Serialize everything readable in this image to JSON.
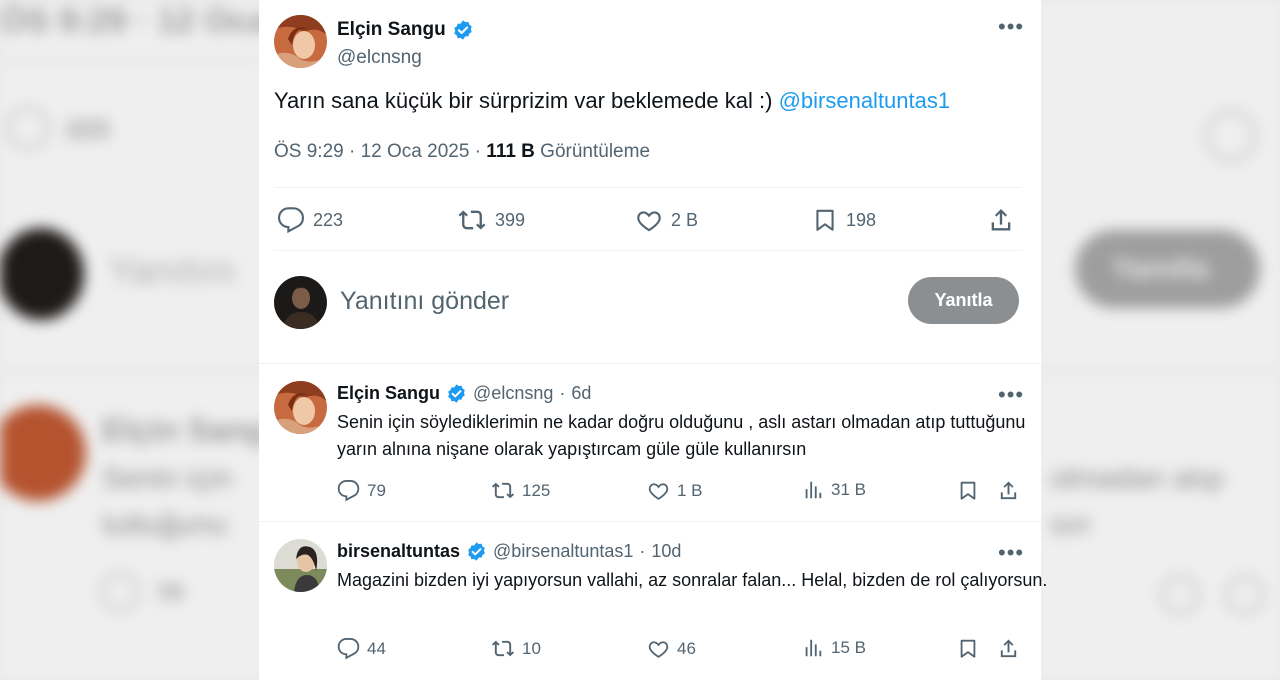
{
  "main_tweet": {
    "author_name": "Elçin Sangu",
    "author_handle": "@elcnsng",
    "text_before": "Yarın sana küçük bir sürprizim var beklemede kal :) ",
    "mention": "@birsenaltuntas1",
    "time": "ÖS 9:29 · 12 Oca 2025 · ",
    "views_count": "111 B",
    "views_label": " Görüntüleme",
    "replies": "223",
    "retweets": "399",
    "likes": "2 B",
    "bookmarks": "198"
  },
  "composer": {
    "placeholder": "Yanıtını gönder",
    "button_label": "Yanıtla"
  },
  "replies": [
    {
      "author_name": "Elçin Sangu",
      "author_handle": "@elcnsng",
      "age": "6d",
      "text": "Senin için söylediklerimin ne kadar doğru olduğunu , aslı astarı olmadan atıp tuttuğunu yarın alnına nişane olarak yapıştırcam güle güle kullanırsın",
      "replies": "79",
      "retweets": "125",
      "likes": "1 B",
      "views": "31 B"
    },
    {
      "author_name": "birsenaltuntas",
      "author_handle": "@birsenaltuntas1",
      "age": "10d",
      "text": "Magazini bizden iyi yapıyorsun vallahi, az sonralar falan... Helal, bizden de rol çalıyorsun.",
      "replies": "44",
      "retweets": "10",
      "likes": "46",
      "views": "15 B"
    }
  ],
  "background": {
    "left_top_text": "ÖS 9:29 · 12 Oca 2",
    "left_count": "223",
    "left_reply_ph": "Yanıtını",
    "right_button": "Yanıtla",
    "left_name": "Elçin Sang",
    "left_text_1": "Senin için",
    "left_text_2": "tuttuğunu",
    "right_text_1": "olmadan atıp",
    "right_text_2": "sın",
    "left_count_2": "79"
  },
  "colors": {
    "accent": "#1d9bf0",
    "muted": "#536471",
    "button_disabled": "#8c8f92"
  }
}
